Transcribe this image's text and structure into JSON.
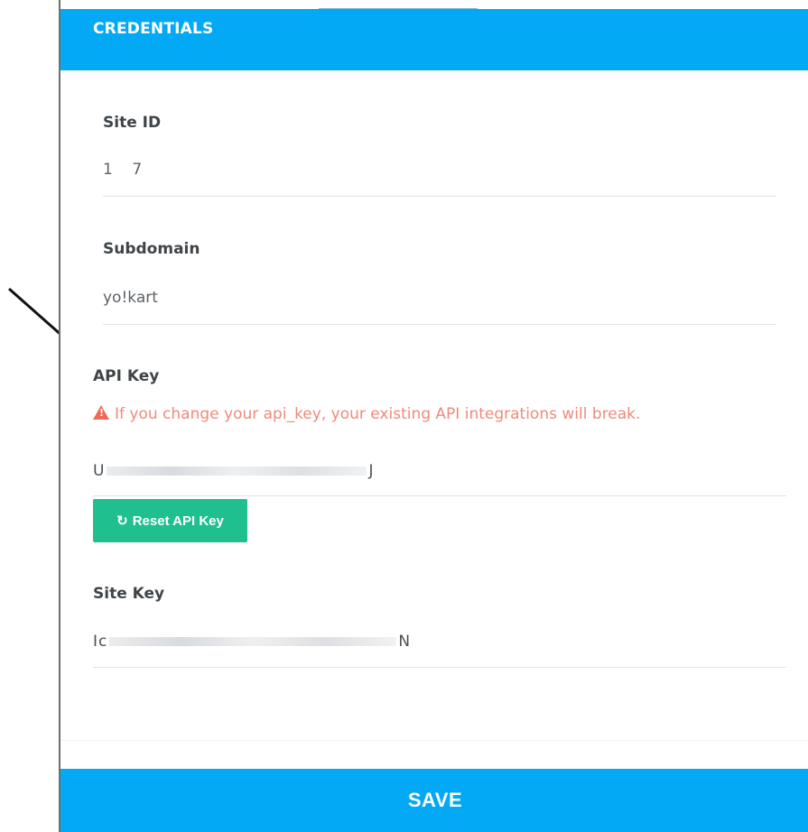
{
  "header": {
    "title": "CREDENTIALS"
  },
  "fields": {
    "site_id": {
      "label": "Site ID",
      "value": "1    7"
    },
    "subdomain": {
      "label": "Subdomain",
      "value": "yo!kart"
    },
    "api_key": {
      "label": "API Key",
      "warning": "If you change your api_key, your existing API integrations will break.",
      "value_prefix": "U",
      "value_suffix": "J"
    },
    "site_key": {
      "label": "Site Key",
      "value_prefix": "Ic",
      "value_suffix": "N"
    }
  },
  "buttons": {
    "reset_api_key": "Reset API Key",
    "save": "SAVE"
  },
  "colors": {
    "header": "#03a9f4",
    "save": "#03a9f4",
    "reset": "#1fbf8f",
    "warning": "#f08a7a"
  },
  "icons": {
    "warning": "warning-triangle-icon",
    "reset": "refresh-icon",
    "annotation": "arrow-icon"
  }
}
